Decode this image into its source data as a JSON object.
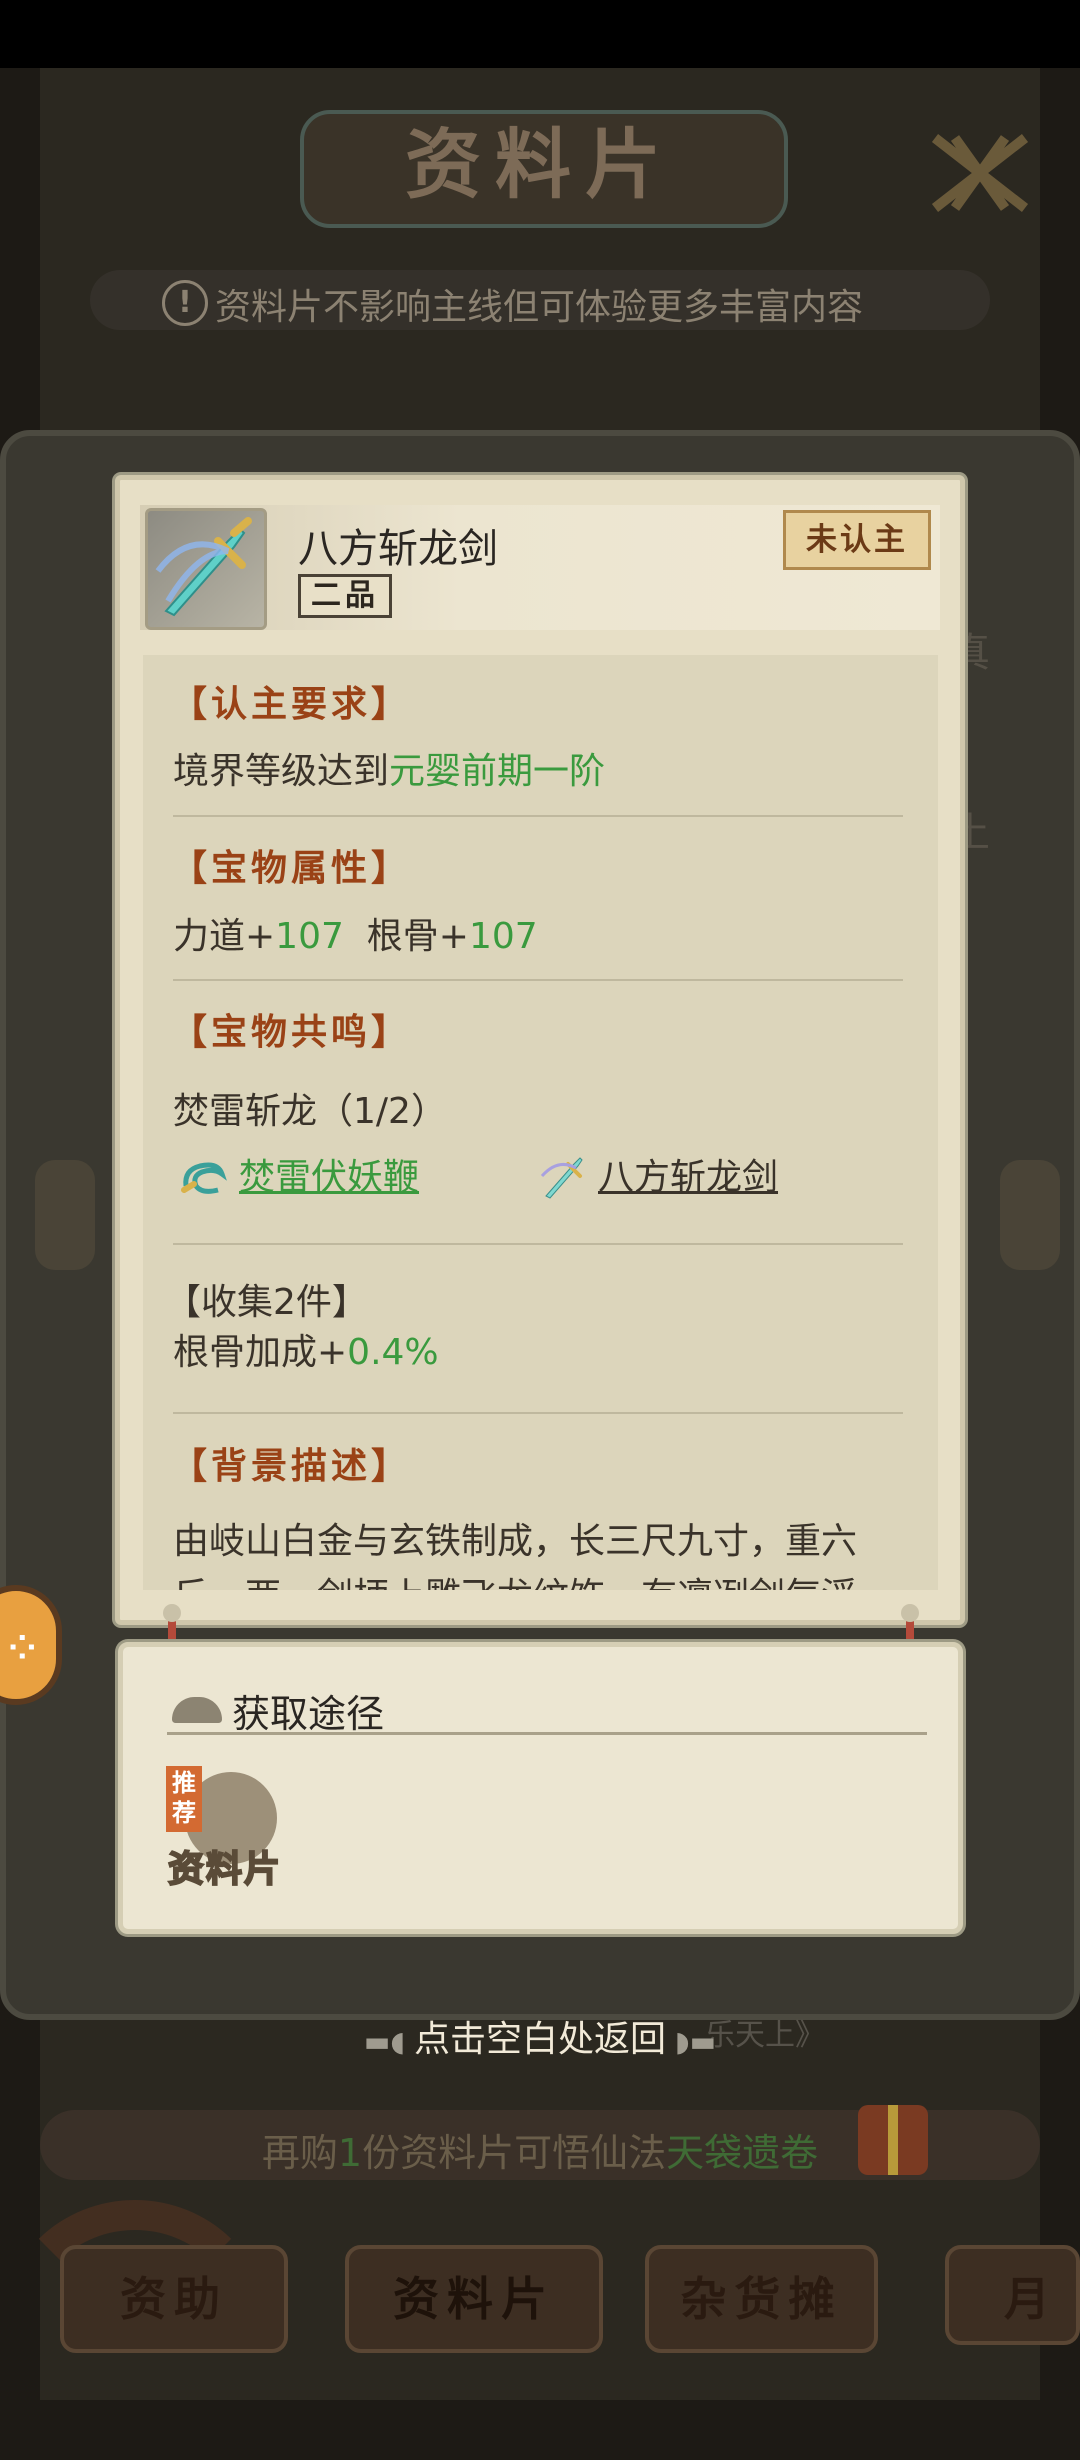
{
  "background": {
    "title": "资料片",
    "notice": "资料片不影响主线但可体验更多丰富内容",
    "side_text_1": "真",
    "side_text_2": "土",
    "return_hint": "点击空白处返回",
    "tag_text": "乐天上》",
    "buy_prefix": "再购",
    "buy_count": "1",
    "buy_middle": "份资料片可悟仙法",
    "buy_highlight": "天袋遗卷",
    "nav": {
      "help": "资助",
      "ziliao": "资料片",
      "shop": "杂货摊",
      "month": "月"
    }
  },
  "item": {
    "name": "八方斩龙剑",
    "grade": "二品",
    "status": "未认主",
    "icon": "sword-icon"
  },
  "sections": {
    "requirement": {
      "title": "【认主要求】",
      "text": "境界等级达到",
      "value": "元婴前期一阶"
    },
    "attributes": {
      "title": "【宝物属性】",
      "attr1_name": "力道+",
      "attr1_value": "107",
      "attr2_name": "根骨+",
      "attr2_value": "107"
    },
    "resonance": {
      "title": "【宝物共鸣】",
      "set_name": "焚雷斩龙（1/2）",
      "items": [
        {
          "name": "焚雷伏妖鞭",
          "owned": true,
          "icon": "whip-icon"
        },
        {
          "name": "八方斩龙剑",
          "owned": false,
          "icon": "sword-icon"
        }
      ],
      "bonus_title": "【收集2件】",
      "bonus_text": "根骨加成+",
      "bonus_value": "0.4%"
    },
    "background": {
      "title": "【背景描述】",
      "line1": "由岐山白金与玄铁制成，长三尺九寸，重六",
      "line2": "斤一两，剑柄上雕飞龙纹饰，有凛冽剑气浮"
    }
  },
  "source": {
    "title": "获取途径",
    "tag": "推荐",
    "label": "资料片"
  },
  "colors": {
    "green": "#3a9a3e",
    "section_title": "#9a4216",
    "card_bg": "#e7dfc6"
  }
}
